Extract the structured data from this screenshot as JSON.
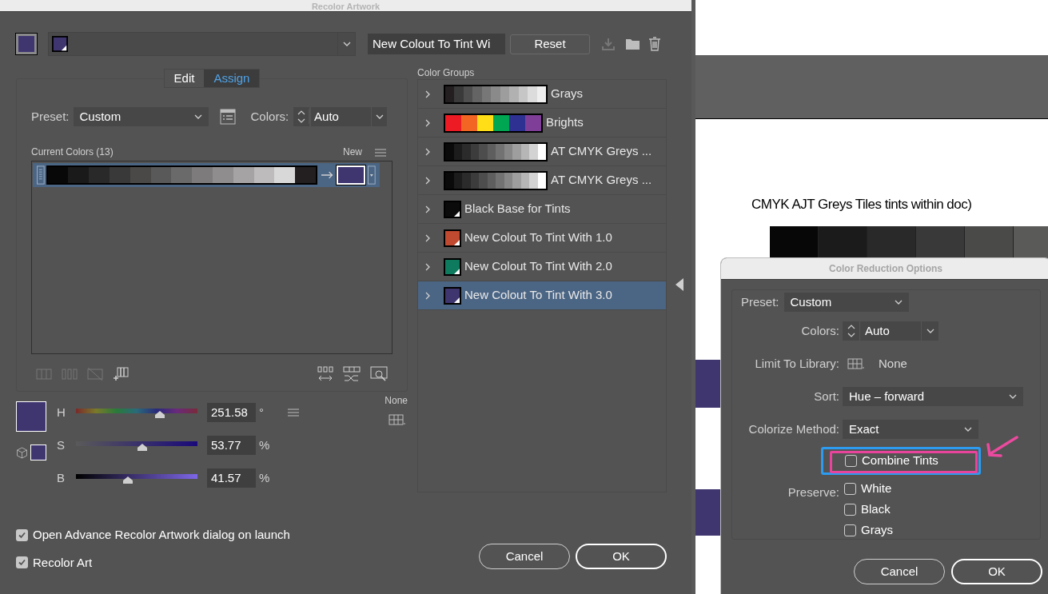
{
  "recolor_dialog": {
    "title": "Recolor Artwork",
    "group_name": "New Colout To Tint Wi",
    "reset_button": "Reset",
    "tabs": [
      {
        "label": "Edit",
        "selected": false
      },
      {
        "label": "Assign",
        "selected": true
      }
    ],
    "preset": {
      "label": "Preset:",
      "value": "Custom"
    },
    "colors": {
      "label": "Colors:",
      "value": "Auto"
    },
    "current_colors": {
      "label": "Current Colors (13)",
      "new_label": "New",
      "rows": [
        {
          "selected": true,
          "swatches": [
            {
              "color": "#080808"
            },
            {
              "color": "#1b1a1a"
            },
            {
              "color": "#2a2929"
            },
            {
              "color": "#3a3939"
            },
            {
              "color": "#4a4948"
            },
            {
              "color": "#5a5959"
            },
            {
              "color": "#6b6a6a"
            },
            {
              "color": "#7d7b7b"
            },
            {
              "color": "#8f8d8d"
            },
            {
              "color": "#a5a3a3"
            },
            {
              "color": "#bdbbbb"
            },
            {
              "color": "#d9d8d8"
            },
            {
              "color": "#231f20"
            }
          ]
        }
      ]
    },
    "hsb": [
      {
        "label": "H",
        "value": "251.58",
        "unit": "°",
        "level": 0.71,
        "kind": "hue"
      },
      {
        "label": "S",
        "value": "53.77",
        "unit": "%",
        "level": 0.55,
        "kind": "saturation"
      },
      {
        "label": "B",
        "value": "41.57",
        "unit": "%",
        "level": 0.42,
        "kind": "brightness"
      }
    ],
    "library": "None",
    "options": [
      {
        "label": "Open Advance Recolor Artwork dialog on launch",
        "checked": true
      },
      {
        "label": "Recolor Art",
        "checked": true
      }
    ],
    "buttons": [
      {
        "label": "Cancel",
        "kind": "secondary"
      },
      {
        "label": "OK",
        "kind": "primary"
      }
    ]
  },
  "color_groups": {
    "title": "Color Groups",
    "items": [
      {
        "name": "Grays",
        "selected": false,
        "swatches": [
          {
            "color": "#231f20"
          },
          {
            "color": "#3a3a3a"
          },
          {
            "color": "#4f4f4f"
          },
          {
            "color": "#646464"
          },
          {
            "color": "#777777"
          },
          {
            "color": "#8a8a8a"
          },
          {
            "color": "#9d9d9d"
          },
          {
            "color": "#b1b1b1"
          },
          {
            "color": "#c6c6c6"
          },
          {
            "color": "#dcdcdc"
          },
          {
            "color": "#efefef"
          }
        ]
      },
      {
        "name": "Brights",
        "selected": false,
        "swatches": [
          {
            "color": "#ed1c24"
          },
          {
            "color": "#f26522"
          },
          {
            "color": "#ffde17"
          },
          {
            "color": "#00a651"
          },
          {
            "color": "#2e3192"
          },
          {
            "color": "#7f3f98"
          }
        ]
      },
      {
        "name": "AT CMYK Greys ...",
        "selected": false,
        "swatches": [
          {
            "color": "#0a0a0a"
          },
          {
            "color": "#1c1c1c"
          },
          {
            "color": "#2b2b2b"
          },
          {
            "color": "#3c3c3c"
          },
          {
            "color": "#4d4d4d"
          },
          {
            "color": "#5e5e5e"
          },
          {
            "color": "#727272"
          },
          {
            "color": "#878787"
          },
          {
            "color": "#9e9e9e"
          },
          {
            "color": "#b6b6b6"
          },
          {
            "color": "#d3d3d3"
          },
          {
            "color": "#ffffff"
          }
        ]
      },
      {
        "name": "AT CMYK Greys ...",
        "selected": false,
        "swatches": [
          {
            "color": "#0a0a0a"
          },
          {
            "color": "#1c1c1c"
          },
          {
            "color": "#2b2b2b"
          },
          {
            "color": "#3c3c3c"
          },
          {
            "color": "#4d4d4d"
          },
          {
            "color": "#5e5e5e"
          },
          {
            "color": "#727272"
          },
          {
            "color": "#878787"
          },
          {
            "color": "#9e9e9e"
          },
          {
            "color": "#b6b6b6"
          },
          {
            "color": "#d3d3d3"
          },
          {
            "color": "#ffffff"
          }
        ]
      },
      {
        "name": "Black Base for Tints",
        "selected": false,
        "swatches": [
          {
            "color": "#0b0b0b"
          }
        ]
      },
      {
        "name": "New Colout To Tint With 1.0",
        "selected": false,
        "swatches": [
          {
            "color": "#bf4a30"
          }
        ]
      },
      {
        "name": "New Colout To Tint With 2.0",
        "selected": false,
        "swatches": [
          {
            "color": "#0e7b5e"
          }
        ]
      },
      {
        "name": "New Colout To Tint With 3.0",
        "selected": true,
        "swatches": [
          {
            "color": "#3f3670"
          }
        ]
      }
    ]
  },
  "document": {
    "caption": "CMYK AJT Greys Tiles tints within doc)",
    "tiles": [
      {
        "color": "#070707"
      },
      {
        "color": "#1b1b1b"
      },
      {
        "color": "#292929"
      },
      {
        "color": "#3a3939"
      },
      {
        "color": "#4a4a49"
      },
      {
        "color": "#5a5a59"
      }
    ]
  },
  "reduction_dialog": {
    "title": "Color Reduction Options",
    "fields": [
      {
        "label": "Preset:",
        "value": "Custom",
        "kind": "dropdown"
      },
      {
        "label": "Colors:",
        "value": "Auto",
        "kind": "stepper"
      },
      {
        "label": "Limit To Library:",
        "value": "None",
        "kind": "library"
      },
      {
        "label": "Sort:",
        "value": "Hue – forward",
        "kind": "dropdown"
      },
      {
        "label": "Colorize Method:",
        "value": "Exact",
        "kind": "dropdown"
      }
    ],
    "combine_tints": {
      "label": "Combine Tints",
      "checked": false,
      "highlighted": true
    },
    "preserve": {
      "label": "Preserve:",
      "options": [
        {
          "label": "White",
          "checked": false
        },
        {
          "label": "Black",
          "checked": false
        },
        {
          "label": "Grays",
          "checked": false
        }
      ]
    },
    "buttons": [
      {
        "label": "Cancel",
        "kind": "secondary"
      },
      {
        "label": "OK",
        "kind": "primary"
      }
    ]
  }
}
